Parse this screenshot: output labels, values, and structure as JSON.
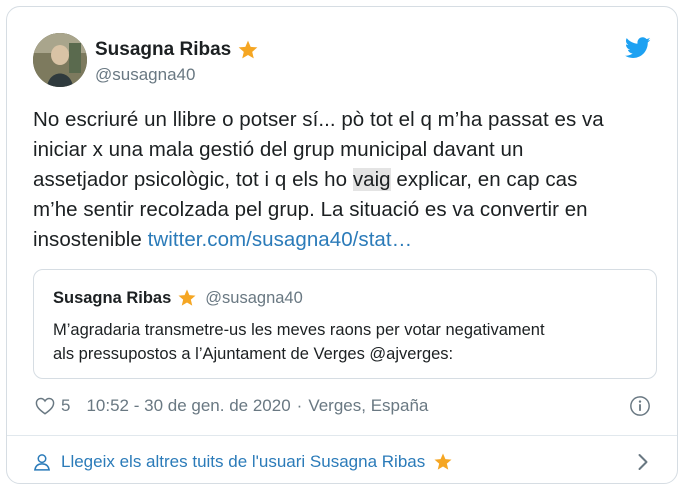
{
  "author": {
    "name": "Susagna Ribas",
    "handle": "@susagna40",
    "verified_icon": "star-icon"
  },
  "tweet": {
    "lines": [
      "No escriuré un llibre o potser sí... pò tot el q m’ha passat es va",
      "iniciar x una mala gestió del grup municipal davant un"
    ],
    "line3_before": "assetjador psicològic, tot i q els ho ",
    "line3_highlight": "vaig",
    "line3_after": " explicar, en cap cas",
    "line4": "m’he sentir recolzada pel grup. La situació es va convertir en",
    "line5_text": "insostenible ",
    "line5_link": "twitter.com/susagna40/stat…"
  },
  "quoted": {
    "name": "Susagna Ribas",
    "handle": "@susagna40",
    "text_line1": "M’agradaria transmetre-us les meves raons per votar negativament",
    "text_line2": "als pressupostos a l’Ajuntament de Verges @ajverges:"
  },
  "meta": {
    "like_count": "5",
    "timestamp": "10:52 - 30 de gen. de 2020",
    "separator": "·",
    "location": "Verges, España"
  },
  "footer": {
    "label": "Llegeix els altres tuits de l'usuari Susagna Ribas"
  },
  "colors": {
    "brand": "#1da1f2",
    "link": "#2b7bb9",
    "star": "#f5a623",
    "muted": "#697882"
  }
}
